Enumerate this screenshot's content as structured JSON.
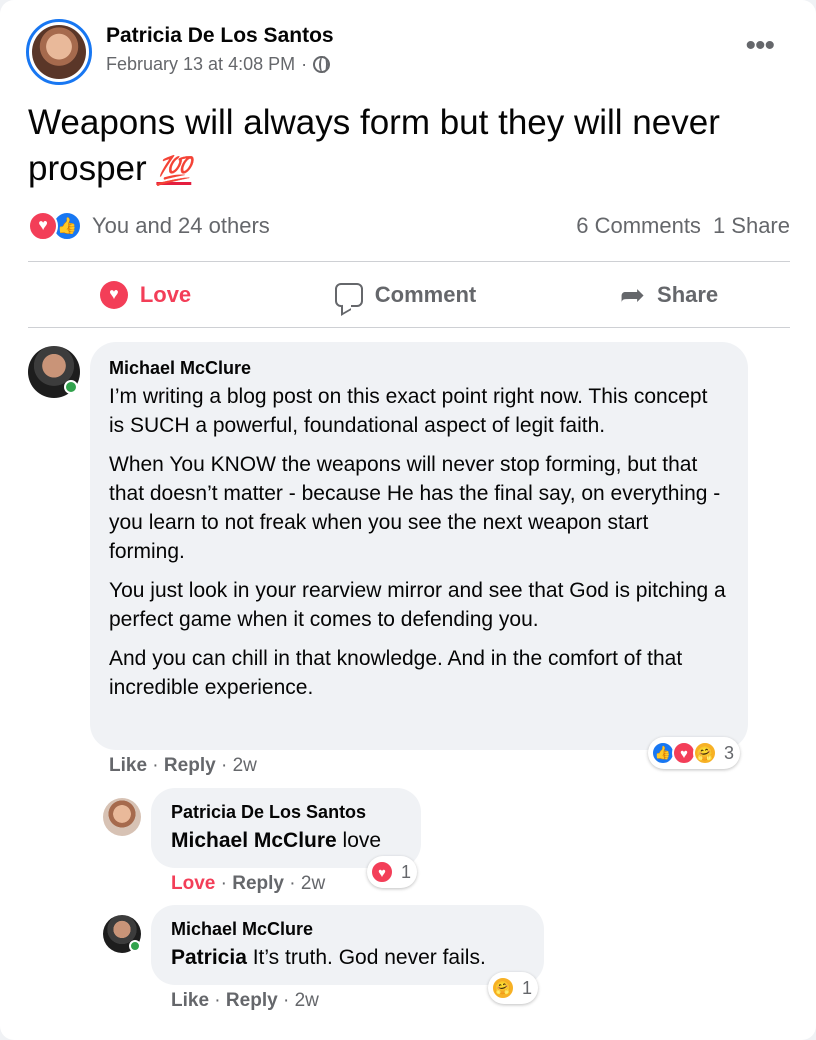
{
  "post": {
    "author": "Patricia De Los Santos",
    "timestamp": "February 13 at 4:08 PM",
    "separator": "·",
    "text": "Weapons will always form but they will never prosper",
    "emoji": "💯",
    "reactions_summary": "You and 24 others",
    "comments_count": "6 Comments",
    "shares_count": "1 Share",
    "reaction_icons": [
      "love-icon",
      "like-icon"
    ]
  },
  "actions": {
    "love": "Love",
    "comment": "Comment",
    "share": "Share"
  },
  "comments": [
    {
      "author": "Michael McClure",
      "paragraphs": [
        "I’m writing a blog post on this exact point right now. This concept is SUCH a powerful, foundational aspect of legit faith.",
        "When You KNOW the weapons will never stop forming, but that that doesn’t matter - because He has the final say, on everything - you learn to not freak when you see the next weapon start forming.",
        "You just look in your rearview mirror and see that God is pitching a perfect game when it comes to defending you.",
        "And you can chill in that knowledge. And in the comfort of that incredible experience."
      ],
      "like": "Like",
      "reply": "Reply",
      "age": "2w",
      "reaction_count": "3"
    },
    {
      "author": "Patricia De Los Santos",
      "mention": "Michael McClure",
      "text": " love",
      "like": "Love",
      "reply": "Reply",
      "age": "2w",
      "reaction_count": "1"
    },
    {
      "author": "Michael McClure",
      "mention": "Patricia",
      "text": " It’s truth. God never fails.",
      "like": "Like",
      "reply": "Reply",
      "age": "2w",
      "reaction_count": "1"
    }
  ],
  "colors": {
    "brand_blue": "#1877f2",
    "love_red": "#f33e58",
    "secondary_text": "#65676b",
    "bubble_bg": "#f0f2f5",
    "online_green": "#31a24c"
  }
}
